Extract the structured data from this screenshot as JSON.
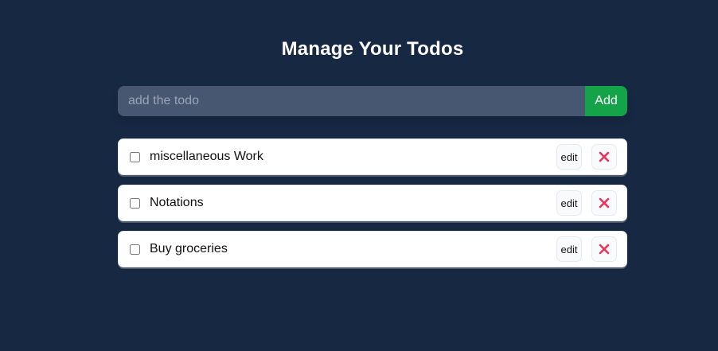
{
  "page": {
    "title": "Manage Your Todos"
  },
  "form": {
    "input_placeholder": "add the todo",
    "input_value": "",
    "add_label": "Add"
  },
  "todos": [
    {
      "text": "miscellaneous Work",
      "completed": false,
      "edit_label": "edit",
      "delete_icon": "close-icon"
    },
    {
      "text": "Notations",
      "completed": false,
      "edit_label": "edit",
      "delete_icon": "close-icon"
    },
    {
      "text": "Buy groceries",
      "completed": false,
      "edit_label": "edit",
      "delete_icon": "close-icon"
    }
  ],
  "colors": {
    "background": "#172842",
    "input_background": "#485771",
    "add_button": "#15a34a",
    "delete_icon": "#e8365e",
    "card": "#ffffff"
  }
}
